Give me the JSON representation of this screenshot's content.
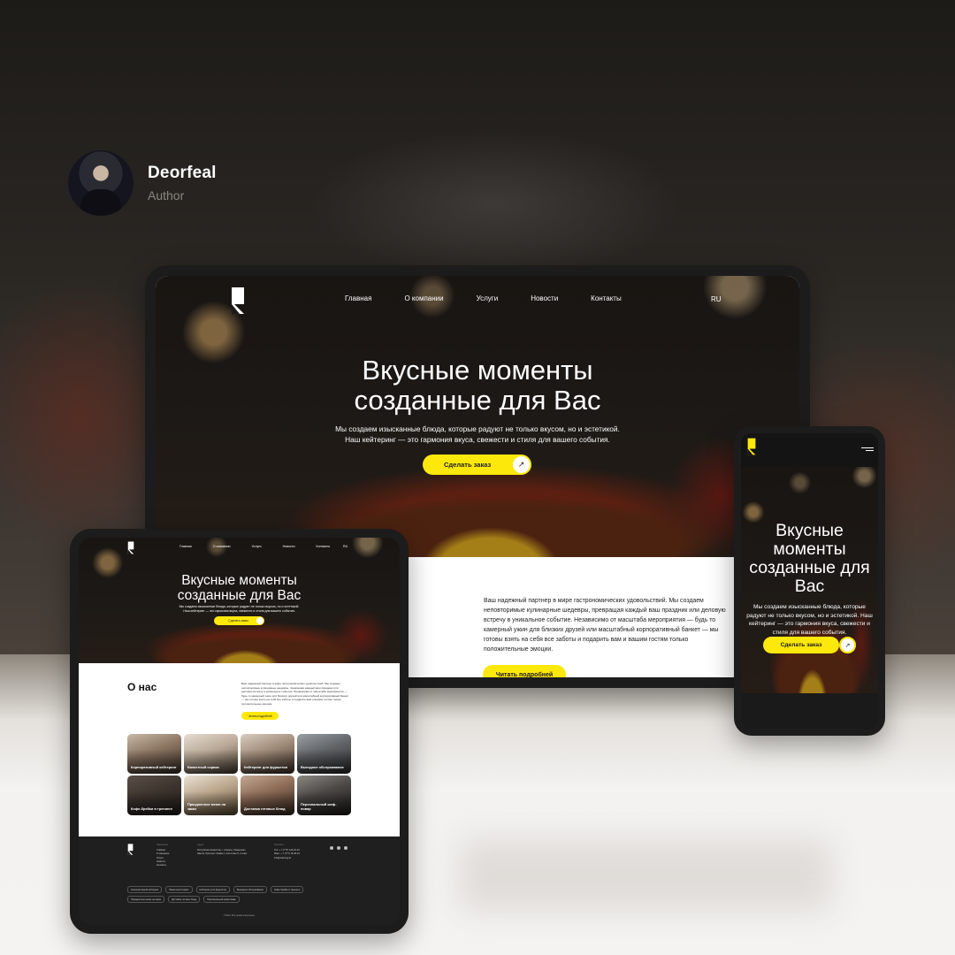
{
  "author": {
    "name": "Deorfeal",
    "role": "Author"
  },
  "colors": {
    "accent": "#fde80b",
    "dark": "#1c1c1c",
    "text_light": "#ffffff"
  },
  "site": {
    "nav": [
      "Главная",
      "О компании",
      "Услуги",
      "Новости",
      "Контакты"
    ],
    "lang": "RU",
    "hero_title_line1": "Вкусные моменты",
    "hero_title_line2": "созданные для Вас",
    "hero_sub_line1": "Мы создаем изысканные блюда, которые радуют не только вкусом, но и эстетикой.",
    "hero_sub_line2": "Наш кейтеринг — это гармония вкуса, свежести и стиля для вашего события.",
    "cta": "Сделать заказ",
    "cta_icon": "arrow-up-right-icon",
    "about_title": "О нас",
    "about_text": "Ваш надежный партнер в мире гастрономических удовольствий. Мы создаем неповторимые кулинарные шедевры, превращая каждый ваш праздник или деловую встречу в уникальное событие. Независимо от масштаба мероприятия — будь то камерный ужин для близких друзей или масштабный корпоративный банкет — мы готовы взять на себя все заботы и подарить вам и вашим гостям только положительные эмоции.",
    "read_more": "Читать подробней"
  },
  "phone": {
    "title_line1": "Вкусные",
    "title_line2": "моменты",
    "title_line3": "созданные для",
    "title_line4": "Вас",
    "sub_line1": "Мы создаем изысканные блюда, которые радуют не только вкусом, но и эстетикой. Наш кейтеринг — это гармония вкуса, свежести и стиля для вашего события."
  },
  "cards": [
    "Корпоративный кейтеринг",
    "Банкетный сервис",
    "Кейтеринг для фуршетов",
    "Выездное обслуживание",
    "Кофе-брейки в тренинге",
    "Праздничное меню на заказ",
    "Доставка готовых блюд",
    "Персональный шеф-повар"
  ],
  "footer": {
    "col1_head": "Навигация",
    "col1_items": [
      "Главная",
      "О компании",
      "Услуги",
      "Новости",
      "Контакты"
    ],
    "col2_head": "Адрес",
    "col2_text": "Республика Казахстан, г. Алматы, Ремерская Школа, Проспект Абайа 2, Алм Алма 5, 3 этаж",
    "col3_head": "Контакты",
    "col3_items": [
      "Тел: + 7 (777) 126-22-23",
      "Факс: + 7 (777) 78-46-19",
      "info@catering.kz"
    ],
    "chips": [
      "Корпоративный кейтеринг",
      "Банкетный сервис",
      "Кейтеринг для фуршетов",
      "Выездное обслуживание",
      "Кофе-брейки в тренинге",
      "Праздничное меню на заказ",
      "Доставка готовых блюд",
      "Персональный шеф-повар"
    ],
    "copyright": "©2024. Все права защищены"
  }
}
